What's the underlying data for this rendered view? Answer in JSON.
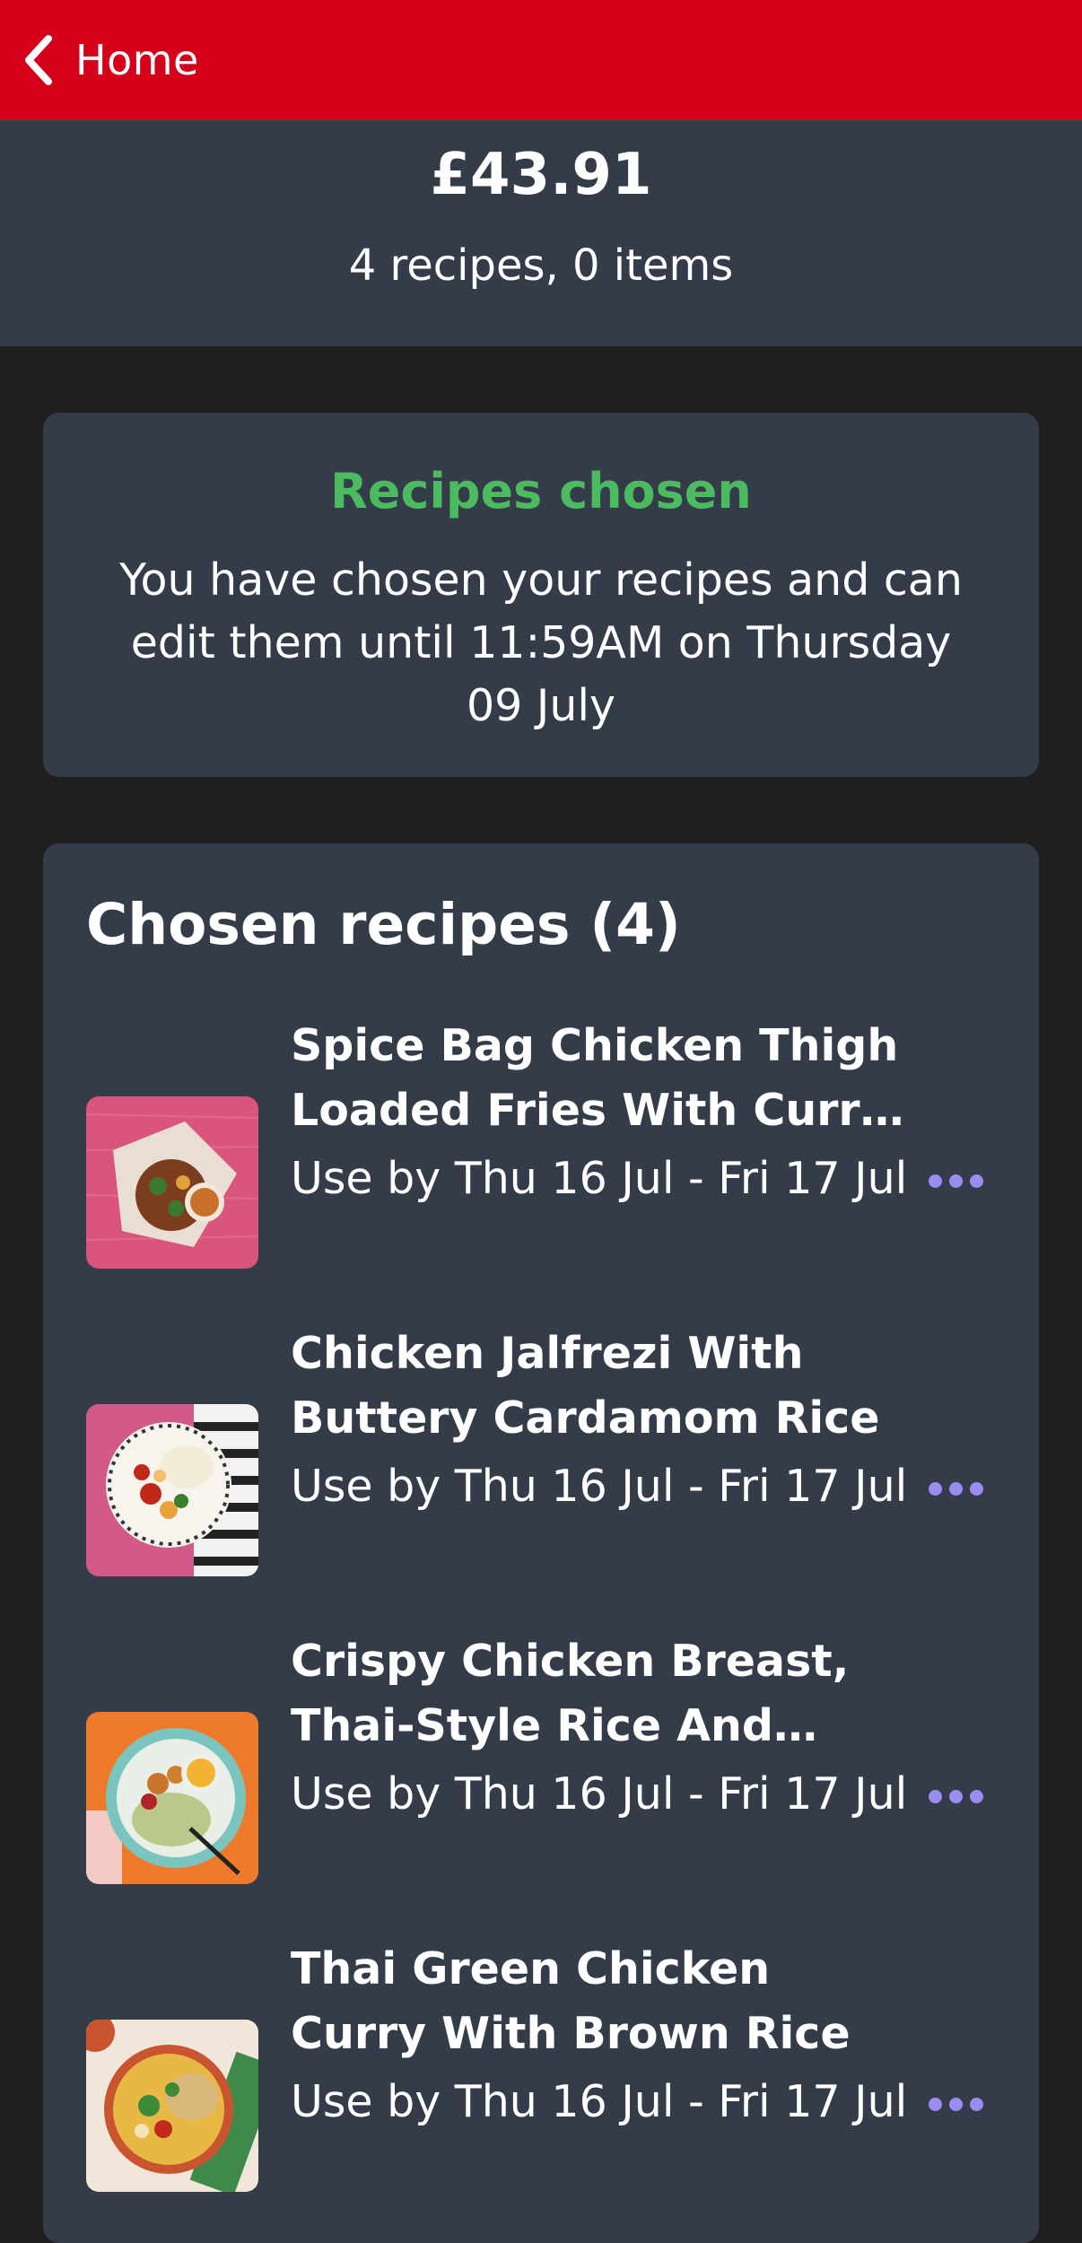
{
  "header": {
    "back_label": "Home",
    "color": "#d5001a"
  },
  "summary": {
    "price": "£43.91",
    "counts": "4 recipes, 0 items"
  },
  "status": {
    "title": "Recipes chosen",
    "title_color": "#4cbb5f",
    "message": "You have chosen your recipes and can edit them until 11:59AM on Thursday 09 July"
  },
  "recipes": {
    "heading": "Chosen recipes (4)",
    "items": [
      {
        "title": "Spice Bag Chicken Thigh Loaded Fries With Curry Sauce",
        "use_by": "Use by Thu 16 Jul - Fri 17 Jul",
        "thumb_icon": "spice-bag-dish-image"
      },
      {
        "title": "Chicken Jalfrezi With Buttery Cardamom Rice",
        "use_by": "Use by Thu 16 Jul - Fri 17 Jul",
        "thumb_icon": "jalfrezi-dish-image"
      },
      {
        "title": "Crispy Chicken Breast, Thai-Style Rice And Peanut Sauce",
        "use_by": "Use by Thu 16 Jul - Fri 17 Jul",
        "thumb_icon": "crispy-chicken-dish-image"
      },
      {
        "title": "Thai Green Chicken Curry With Brown Rice",
        "use_by": "Use by Thu 16 Jul - Fri 17 Jul",
        "thumb_icon": "thai-green-curry-dish-image"
      }
    ]
  },
  "colors": {
    "accent_menu": "#9b8cf2",
    "panel": "#333c48",
    "background": "#1f1f20"
  }
}
